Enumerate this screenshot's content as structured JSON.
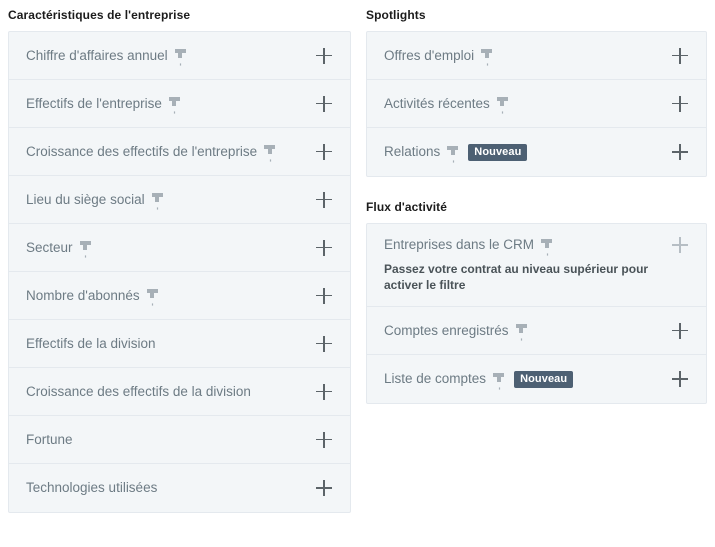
{
  "colors": {
    "card_bg": "#f3f6f8",
    "card_border": "#e4e9ee",
    "label": "#6d7b84",
    "heading": "#1c1c1c",
    "badge_bg": "#4d6073",
    "badge_text": "#ffffff",
    "plus": "#5c6469",
    "plus_disabled": "#b6bec4",
    "pin": "#a7b0b7"
  },
  "icons": {
    "pin": "pin-icon",
    "add": "plus-icon"
  },
  "left_column": {
    "section": {
      "title": "Caractéristiques de l'entreprise",
      "rows": [
        {
          "label": "Chiffre d'affaires annuel",
          "pinned": true,
          "badge": null,
          "note": null,
          "add_enabled": true
        },
        {
          "label": "Effectifs de l'entreprise",
          "pinned": true,
          "badge": null,
          "note": null,
          "add_enabled": true
        },
        {
          "label": "Croissance des effectifs de l'entreprise",
          "pinned": true,
          "badge": null,
          "note": null,
          "add_enabled": true
        },
        {
          "label": "Lieu du siège social",
          "pinned": true,
          "badge": null,
          "note": null,
          "add_enabled": true
        },
        {
          "label": "Secteur",
          "pinned": true,
          "badge": null,
          "note": null,
          "add_enabled": true
        },
        {
          "label": "Nombre d'abonnés",
          "pinned": true,
          "badge": null,
          "note": null,
          "add_enabled": true
        },
        {
          "label": "Effectifs de la division",
          "pinned": false,
          "badge": null,
          "note": null,
          "add_enabled": true
        },
        {
          "label": "Croissance des effectifs de la division",
          "pinned": false,
          "badge": null,
          "note": null,
          "add_enabled": true
        },
        {
          "label": "Fortune",
          "pinned": false,
          "badge": null,
          "note": null,
          "add_enabled": true
        },
        {
          "label": "Technologies utilisées",
          "pinned": false,
          "badge": null,
          "note": null,
          "add_enabled": true
        }
      ]
    }
  },
  "right_column": {
    "sections": [
      {
        "title": "Spotlights",
        "rows": [
          {
            "label": "Offres d'emploi",
            "pinned": true,
            "badge": null,
            "note": null,
            "add_enabled": true
          },
          {
            "label": "Activités récentes",
            "pinned": true,
            "badge": null,
            "note": null,
            "add_enabled": true
          },
          {
            "label": "Relations",
            "pinned": true,
            "badge": "Nouveau",
            "note": null,
            "add_enabled": true
          }
        ]
      },
      {
        "title": "Flux d'activité",
        "rows": [
          {
            "label": "Entreprises dans le CRM",
            "pinned": true,
            "badge": null,
            "note": "Passez votre contrat au niveau supérieur pour activer le filtre",
            "add_enabled": false
          },
          {
            "label": "Comptes enregistrés",
            "pinned": true,
            "badge": null,
            "note": null,
            "add_enabled": true
          },
          {
            "label": "Liste de comptes",
            "pinned": true,
            "badge": "Nouveau",
            "note": null,
            "add_enabled": true
          }
        ]
      }
    ]
  }
}
